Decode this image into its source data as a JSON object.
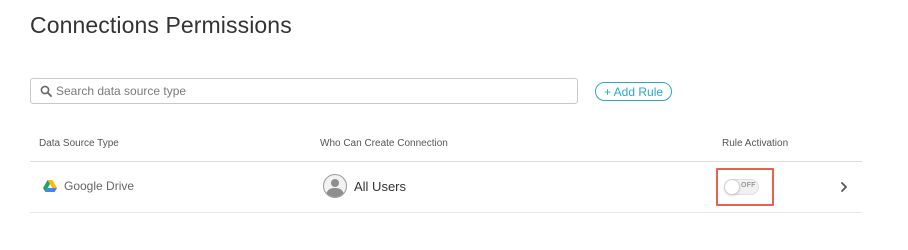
{
  "page": {
    "title": "Connections Permissions"
  },
  "search": {
    "placeholder": "Search data source type",
    "value": "",
    "icon": "search-icon"
  },
  "actions": {
    "add_rule_label": "+ Add Rule"
  },
  "table": {
    "headers": {
      "data_source_type": "Data Source Type",
      "who_can_create": "Who Can Create Connection",
      "rule_activation": "Rule Activation"
    },
    "rows": [
      {
        "data_source": "Google Drive",
        "data_source_icon": "google-drive-icon",
        "who": "All Users",
        "who_icon": "user-avatar-icon",
        "activation_state": "OFF",
        "activation_on": false,
        "row_action_icon": "chevron-right-icon"
      }
    ]
  },
  "colors": {
    "accent": "#2ba8c9",
    "highlight": "#e8614b"
  }
}
